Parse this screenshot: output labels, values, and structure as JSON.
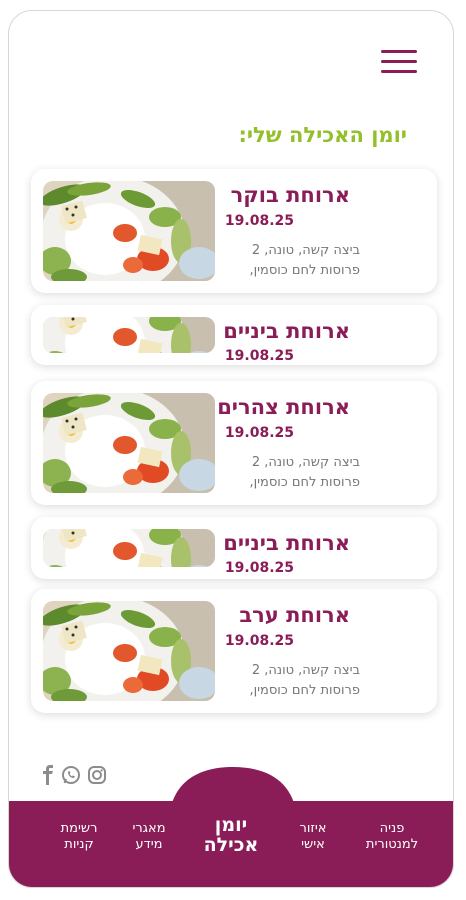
{
  "header": {
    "menu_icon": "hamburger-menu-icon"
  },
  "page_title": "יומן האכילה שלי:",
  "meals": [
    {
      "name": "ארוחת בוקר",
      "date": "19.08.25",
      "desc_line1": "ביצה קשה, טונה, 2",
      "desc_line2": "פרוסות לחם כוסמין,"
    },
    {
      "name": "ארוחת ביניים",
      "date": "19.08.25"
    },
    {
      "name": "ארוחת צהרים",
      "date": "19.08.25",
      "desc_line1": "ביצה קשה, טונה, 2",
      "desc_line2": "פרוסות לחם כוסמין,"
    },
    {
      "name": "ארוחת ביניים",
      "date": "19.08.25"
    },
    {
      "name": "ארוחת ערב",
      "date": "19.08.25",
      "desc_line1": "ביצה קשה, טונה, 2",
      "desc_line2": "פרוסות לחם כוסמין,"
    }
  ],
  "social": [
    "facebook-icon",
    "whatsapp-icon",
    "instagram-icon"
  ],
  "nav": {
    "item1_line1": "רשימת",
    "item1_line2": "קניות",
    "item2_line1": "מאגרי",
    "item2_line2": "מידע",
    "center_line1": "יומן",
    "center_line2": "אכילה",
    "item4_line1": "איזור",
    "item4_line2": "אישי",
    "item5_line1": "פניה",
    "item5_line2": "למנטורית"
  },
  "colors": {
    "brand": "#8a1d57",
    "title": "#93bf2a",
    "text_muted": "#777777"
  }
}
